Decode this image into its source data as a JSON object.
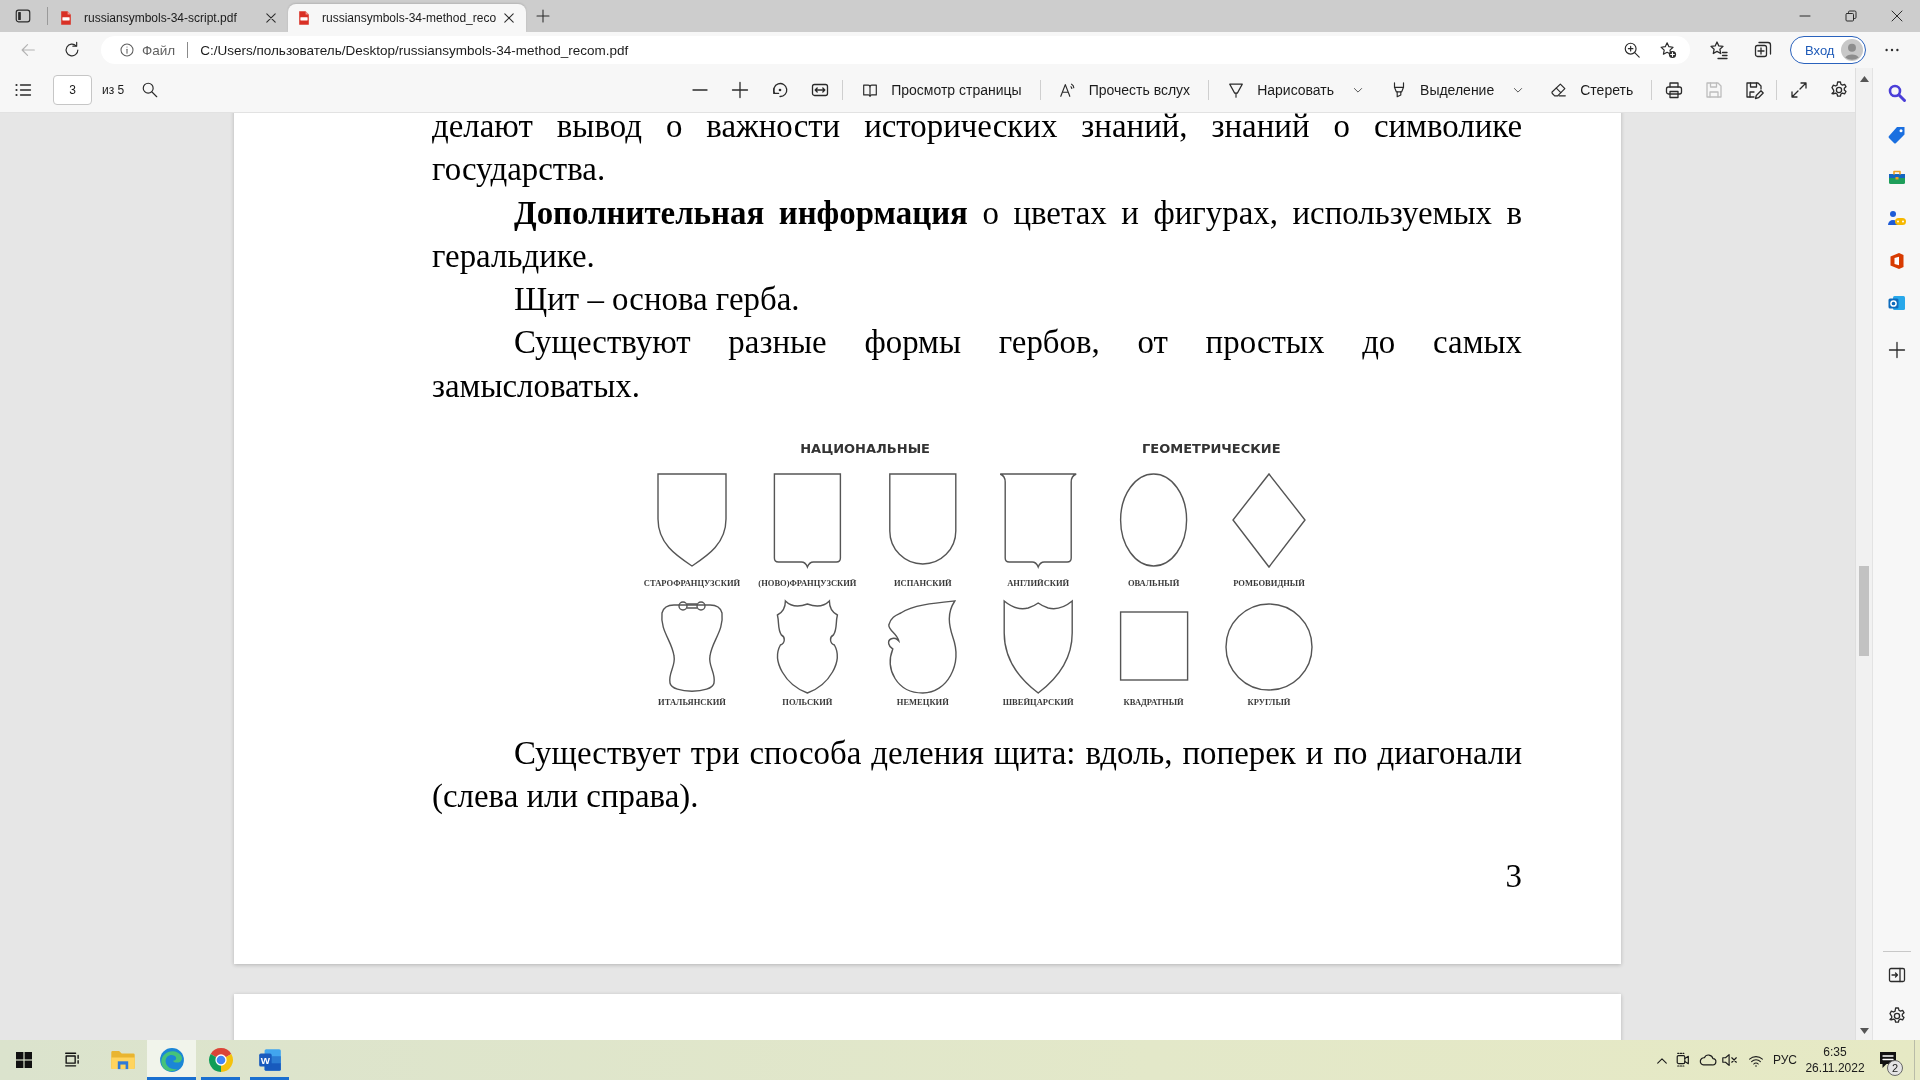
{
  "tabs": [
    {
      "title": "russiansymbols-34-script.pdf",
      "selected": false
    },
    {
      "title": "russiansymbols-34-method_reco",
      "selected": true
    }
  ],
  "navigation": {
    "back": {
      "disabled": true
    }
  },
  "address_bar": {
    "scheme": "Файл",
    "url": "C:/Users/пользователь/Desktop/russiansymbols-34-method_recom.pdf"
  },
  "profile_button": {
    "label": "Вход"
  },
  "pdf_toolbar": {
    "page": "3",
    "page_total": "из 5",
    "tools": [
      {
        "kind": "page-view",
        "label": "Просмотр страницы",
        "dropdown": false
      },
      {
        "kind": "read-aloud",
        "label": "Прочесть вслух",
        "dropdown": false
      },
      {
        "kind": "draw",
        "label": "Нарисовать",
        "dropdown": true
      },
      {
        "kind": "highlight",
        "label": "Выделение",
        "dropdown": true
      },
      {
        "kind": "erase",
        "label": "Стереть",
        "dropdown": false
      }
    ],
    "actions": [
      {
        "kind": "print",
        "disabled": false
      },
      {
        "kind": "save",
        "disabled": true
      },
      {
        "kind": "save-as",
        "disabled": false
      }
    ]
  },
  "document": {
    "blocks": [
      {
        "kind": "continuation",
        "text": "делают вывод о важности исторических знаний, знаний о символике государства."
      },
      {
        "kind": "paragraph",
        "text": "**Дополнительная информация** о цветах и фигурах, используемых в геральдике."
      },
      {
        "kind": "paragraph",
        "text": "Щит – основа герба."
      },
      {
        "kind": "paragraph",
        "text": "Существуют разные формы гербов, от простых до самых замысловатых."
      },
      {
        "kind": "figure",
        "groups": [
          {
            "heading": "НАЦИОНАЛЬНЫЕ",
            "shapes": [
              {
                "kind": "old-french",
                "label": "СТАРОФРАНЦУЗСКИЙ"
              },
              {
                "kind": "new-french",
                "label": "(НОВО)ФРАНЦУЗСКИЙ"
              },
              {
                "kind": "spanish",
                "label": "ИСПАНСКИЙ"
              },
              {
                "kind": "english",
                "label": "АНГЛИЙСКИЙ"
              },
              {
                "kind": "italian",
                "label": "ИТАЛЬЯНСКИЙ"
              },
              {
                "kind": "polish",
                "label": "ПОЛЬСКИЙ"
              },
              {
                "kind": "german",
                "label": "НЕМЕЦКИЙ"
              },
              {
                "kind": "swiss",
                "label": "ШВЕЙЦАРСКИЙ"
              }
            ]
          },
          {
            "heading": "ГЕОМЕТРИЧЕСКИЕ",
            "shapes": [
              {
                "kind": "oval",
                "label": "ОВАЛЬНЫЙ"
              },
              {
                "kind": "rhombus",
                "label": "РОМБОВИДНЫЙ"
              },
              {
                "kind": "square",
                "label": "КВАДРАТНЫЙ"
              },
              {
                "kind": "circle",
                "label": "КРУГЛЫЙ"
              }
            ]
          }
        ]
      },
      {
        "kind": "paragraph",
        "text": "Существует три способа деления щита: вдоль, поперек и по диагонали (слева или справа)."
      }
    ],
    "page_number": "3"
  },
  "taskbar": {
    "apps": [
      {
        "kind": "folder",
        "active": false,
        "running": false
      },
      {
        "kind": "swirl",
        "active": true,
        "running": true
      },
      {
        "kind": "wheel",
        "active": false,
        "running": true
      },
      {
        "kind": "tiles",
        "letter": "W",
        "active": false,
        "running": true
      }
    ],
    "tray": {
      "volume_muted": true,
      "language": "РУС",
      "time": "6:35",
      "date": "26.11.2022",
      "notifications": "2"
    }
  }
}
